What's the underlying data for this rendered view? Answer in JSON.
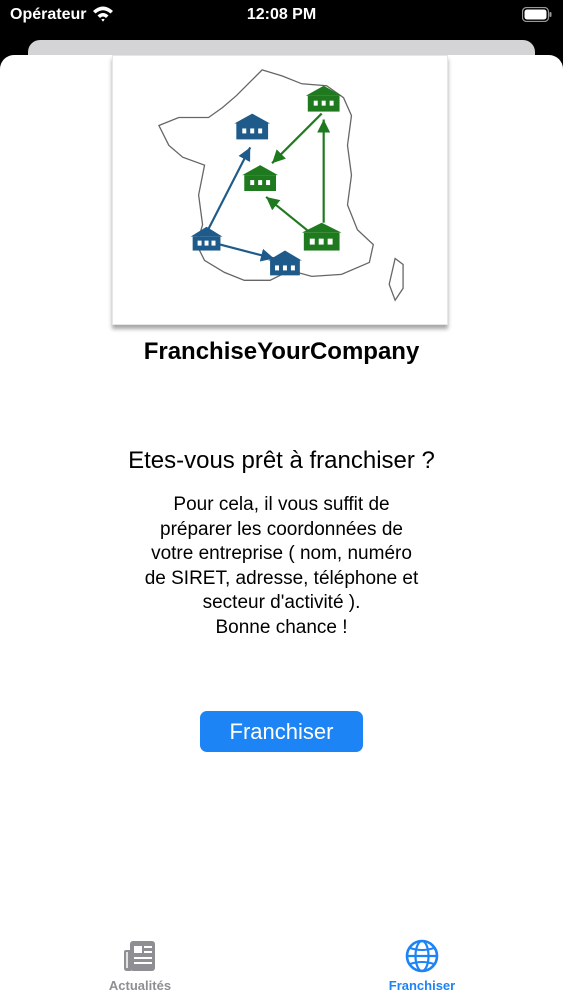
{
  "status_bar": {
    "carrier": "Opérateur",
    "time": "12:08 PM"
  },
  "main": {
    "title": "FranchiseYourCompany",
    "question": "Etes-vous prêt à franchiser ?",
    "description_lines": [
      "Pour cela, il vous suffit de",
      "préparer les coordonnées de",
      "votre entreprise ( nom, numéro",
      "de SIRET, adresse, téléphone et",
      "secteur d'activité ).",
      "Bonne chance !"
    ],
    "button_label": "Franchiser"
  },
  "tab_bar": {
    "tabs": [
      {
        "label": "Actualités",
        "icon": "newspaper-icon",
        "selected": false
      },
      {
        "label": "Franchiser",
        "icon": "globe-icon",
        "selected": true
      }
    ]
  },
  "colors": {
    "accent": "#1d84f5",
    "house_blue": "#1f5b8a",
    "house_green": "#1f7a1f",
    "inactive": "#8e8e93"
  }
}
